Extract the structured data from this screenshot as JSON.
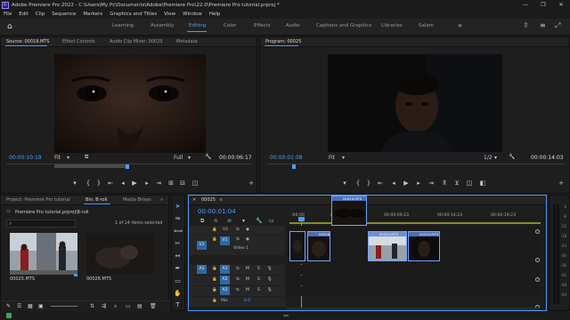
{
  "window": {
    "app_icon": "Pr",
    "title": "Adobe Premiere Pro 2022 - C:\\Users\\My Pc\\Documents\\Adobe\\Premiere Pro\\22.0\\Premiere Pro tutorial.prproj *",
    "controls": [
      "—",
      "❐",
      "✕"
    ]
  },
  "menu": [
    "File",
    "Edit",
    "Clip",
    "Sequence",
    "Markers",
    "Graphics and Titles",
    "View",
    "Window",
    "Help"
  ],
  "workspaces": {
    "tabs": [
      "Learning",
      "Assembly",
      "Editing",
      "Color",
      "Effects",
      "Audio",
      "Captions and Graphics",
      "Libraries",
      "Salam"
    ],
    "active": "Editing",
    "more": "»"
  },
  "source_panel": {
    "tabs": [
      "Source: 00019.MTS",
      "Effect Controls",
      "Audio Clip Mixer: 00025",
      "Metadata"
    ],
    "timecode_in": "00:00:10:19",
    "fit": "Fit",
    "quality": "Full",
    "timecode_out": "00:00:06:17"
  },
  "program_panel": {
    "tabs": [
      "Program: 00025"
    ],
    "timecode_in": "00:00:01:08",
    "fit": "Fit",
    "scale": "1/2",
    "timecode_out": "00:00:14:03"
  },
  "project_panel": {
    "tabs": [
      "Project: Premiere Pro tutorial",
      "Bin: B-roll",
      "Media Brows"
    ],
    "path": "Premiere Pro tutorial.prproj\\B-roll",
    "items_selected": "1 of 14 items selected",
    "clips": [
      {
        "name": "00025.MTS"
      },
      {
        "name": "00026.MTS"
      }
    ]
  },
  "timeline": {
    "sequence_tab": "00025",
    "playhead_time": "00:00:01:04",
    "ruler_labels": [
      ":00:00",
      "00:00:04:23",
      "00:00:09:23",
      "00:00:14:23",
      "00:00:19:23"
    ],
    "tracks": {
      "v2": "V2",
      "v1": "V1",
      "v1_name": "Video 1",
      "a1": "A1",
      "a2": "A2",
      "a3": "A3",
      "mix": "Mix",
      "mix_value": "0.0",
      "src_v1": "V1",
      "src_a1": "A1"
    },
    "clip_labels": [
      "00026",
      "00019.MTS",
      "00023.MTS",
      "00020.MTS"
    ],
    "meter_ticks": [
      "0",
      "-6",
      "-12",
      "-18",
      "-24",
      "-30",
      "-36",
      "-42",
      "-48",
      "-54"
    ]
  },
  "colors": {
    "accent": "#4f9ef8",
    "clip_video": "#4a6fb5",
    "clip_video_alt": "#6c8ed6",
    "track_target": "#2c6ba6"
  }
}
